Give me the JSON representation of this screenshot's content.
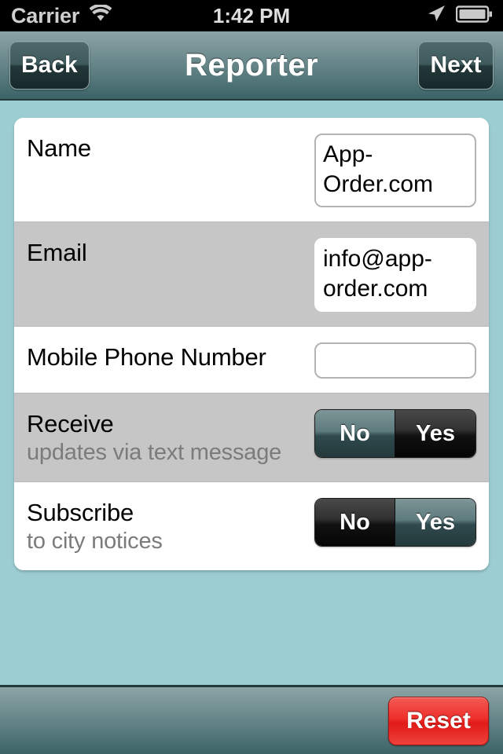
{
  "status_bar": {
    "carrier": "Carrier",
    "time": "1:42 PM",
    "wifi_icon": "wifi-icon",
    "location_icon": "location-arrow-icon",
    "battery_icon": "battery-icon"
  },
  "nav": {
    "back_label": "Back",
    "title": "Reporter",
    "next_label": "Next"
  },
  "form": {
    "rows": [
      {
        "label": "Name",
        "sublabel": "",
        "type": "text",
        "value": "App-Order.com",
        "placeholder": "",
        "shaded": false,
        "bordered": true
      },
      {
        "label": "Email",
        "sublabel": "",
        "type": "text",
        "value": "info@app-order.com",
        "placeholder": "",
        "shaded": true,
        "bordered": false
      },
      {
        "label": "Mobile Phone Number",
        "sublabel": "",
        "type": "text",
        "value": "",
        "placeholder": "",
        "shaded": false,
        "bordered": true
      },
      {
        "label": "Receive",
        "sublabel": "updates via text message",
        "type": "segmented",
        "options": [
          "No",
          "Yes"
        ],
        "selected": "Yes",
        "shaded": true
      },
      {
        "label": "Subscribe",
        "sublabel": "to city notices",
        "type": "segmented",
        "options": [
          "No",
          "Yes"
        ],
        "selected": "No",
        "shaded": false
      }
    ]
  },
  "toolbar": {
    "reset_label": "Reset"
  },
  "colors": {
    "page_background": "#9ccdd2",
    "nav_bar_top": "#8ba3a5",
    "nav_bar_bottom": "#3c6366",
    "row_shaded": "#c6c6c6",
    "sublabel_text": "#7b7b7b",
    "reset_accent": "#e01b17",
    "segment_selected": "#111111",
    "segment_unselected": "#5e7b7e"
  }
}
